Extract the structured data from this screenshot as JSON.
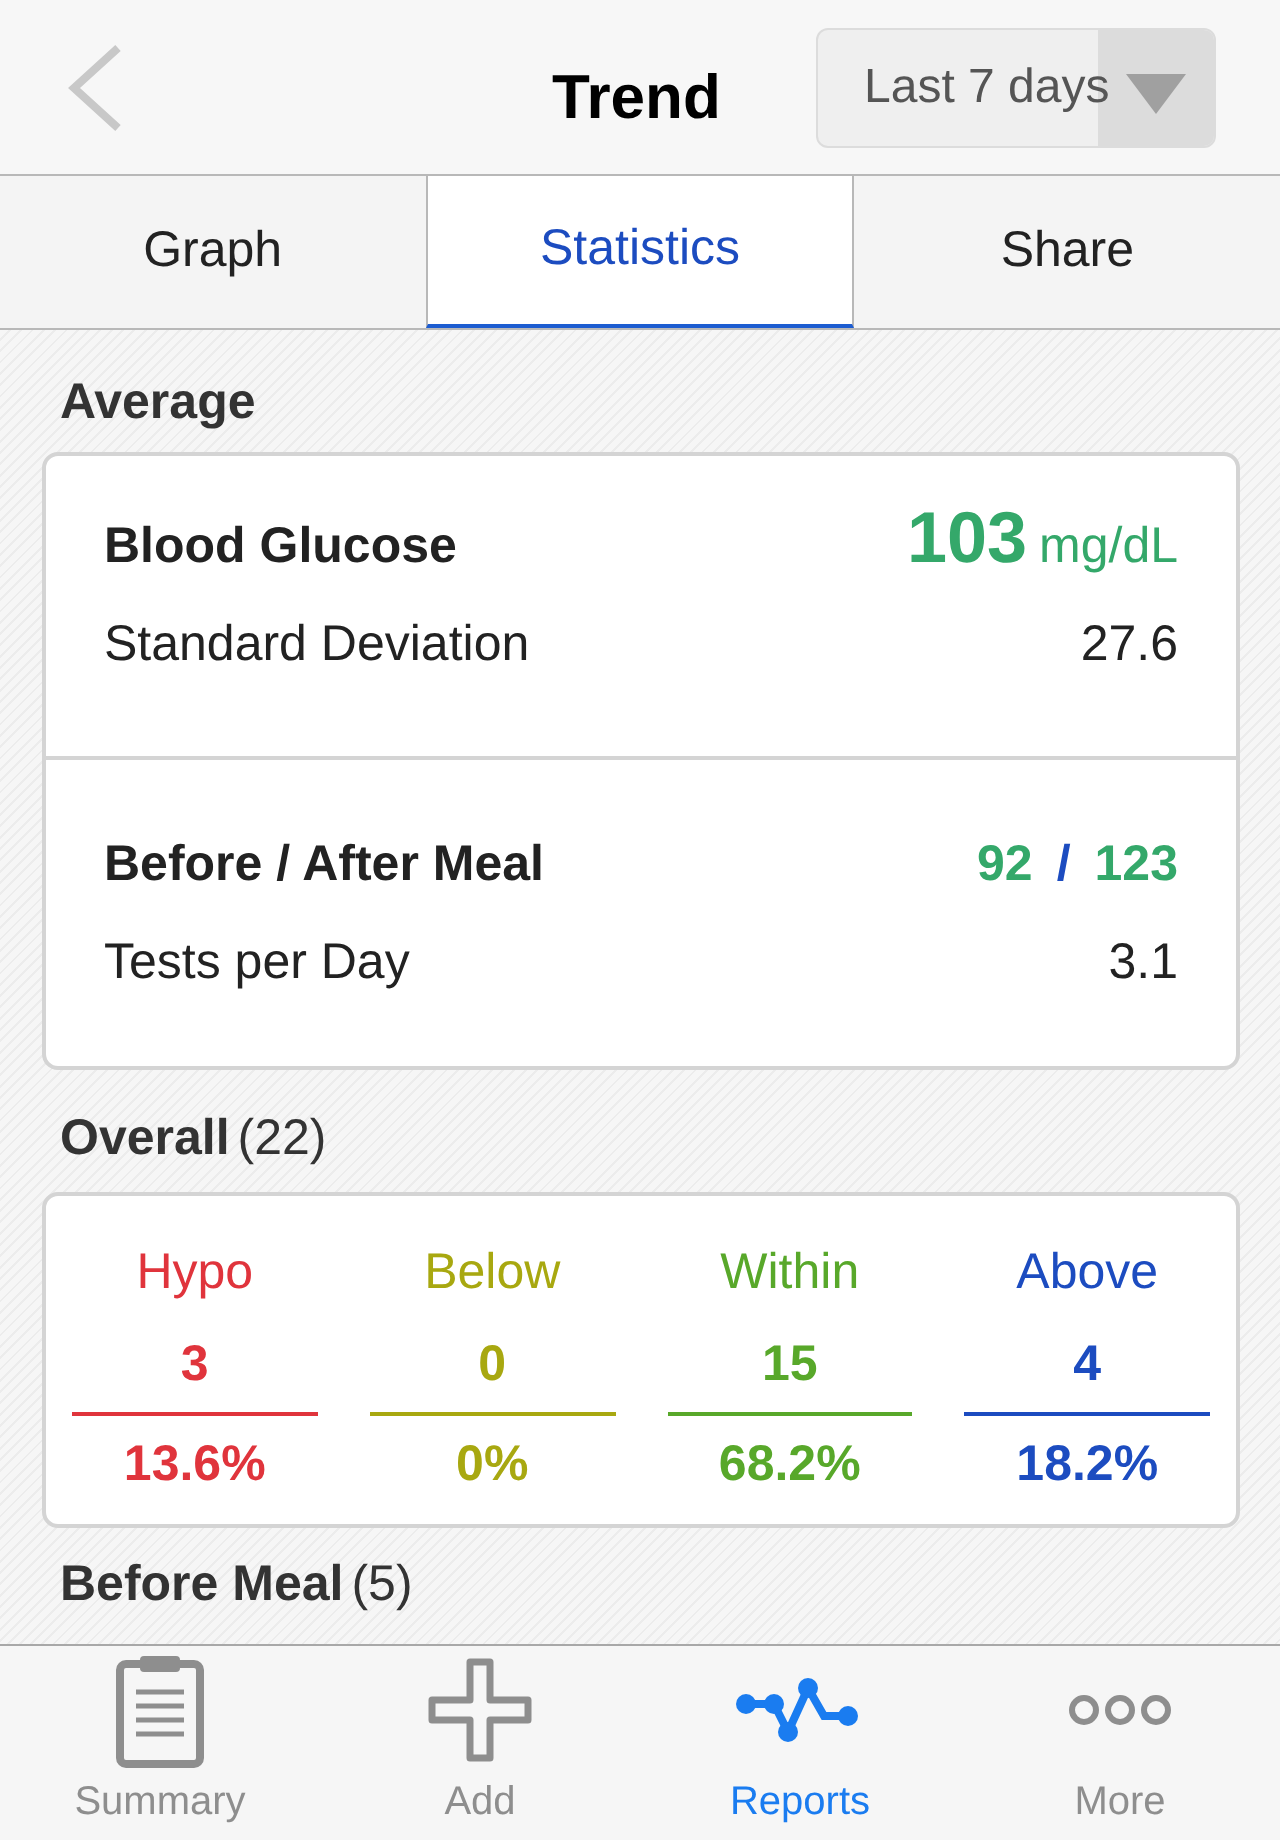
{
  "header": {
    "title": "Trend",
    "range": "Last 7 days"
  },
  "tabs": [
    {
      "label": "Graph",
      "selected": false
    },
    {
      "label": "Statistics",
      "selected": true
    },
    {
      "label": "Share",
      "selected": false
    }
  ],
  "average": {
    "heading": "Average",
    "blood_glucose": {
      "label": "Blood Glucose",
      "value": "103",
      "unit": "mg/dL"
    },
    "std_dev": {
      "label": "Standard Deviation",
      "value": "27.6"
    },
    "meal": {
      "label": "Before / After Meal",
      "before": "92",
      "separator": "/",
      "after": "123"
    },
    "tests": {
      "label": "Tests per Day",
      "value": "3.1"
    }
  },
  "overall": {
    "heading": "Overall",
    "count": "(22)",
    "ranges": [
      {
        "label": "Hypo",
        "count": "3",
        "percent": "13.6%",
        "color": "#e0343c"
      },
      {
        "label": "Below",
        "count": "0",
        "percent": "0%",
        "color": "#a8a810"
      },
      {
        "label": "Within",
        "count": "15",
        "percent": "68.2%",
        "color": "#58a82a"
      },
      {
        "label": "Above",
        "count": "4",
        "percent": "18.2%",
        "color": "#1c4cc0"
      }
    ]
  },
  "before_meal": {
    "heading": "Before Meal",
    "count": "(5)"
  },
  "tab_bar": [
    {
      "kind": "summary",
      "label": "Summary",
      "selected": false
    },
    {
      "kind": "add",
      "label": "Add",
      "selected": false
    },
    {
      "kind": "reports",
      "label": "Reports",
      "selected": true
    },
    {
      "kind": "more",
      "label": "More",
      "selected": false
    }
  ]
}
